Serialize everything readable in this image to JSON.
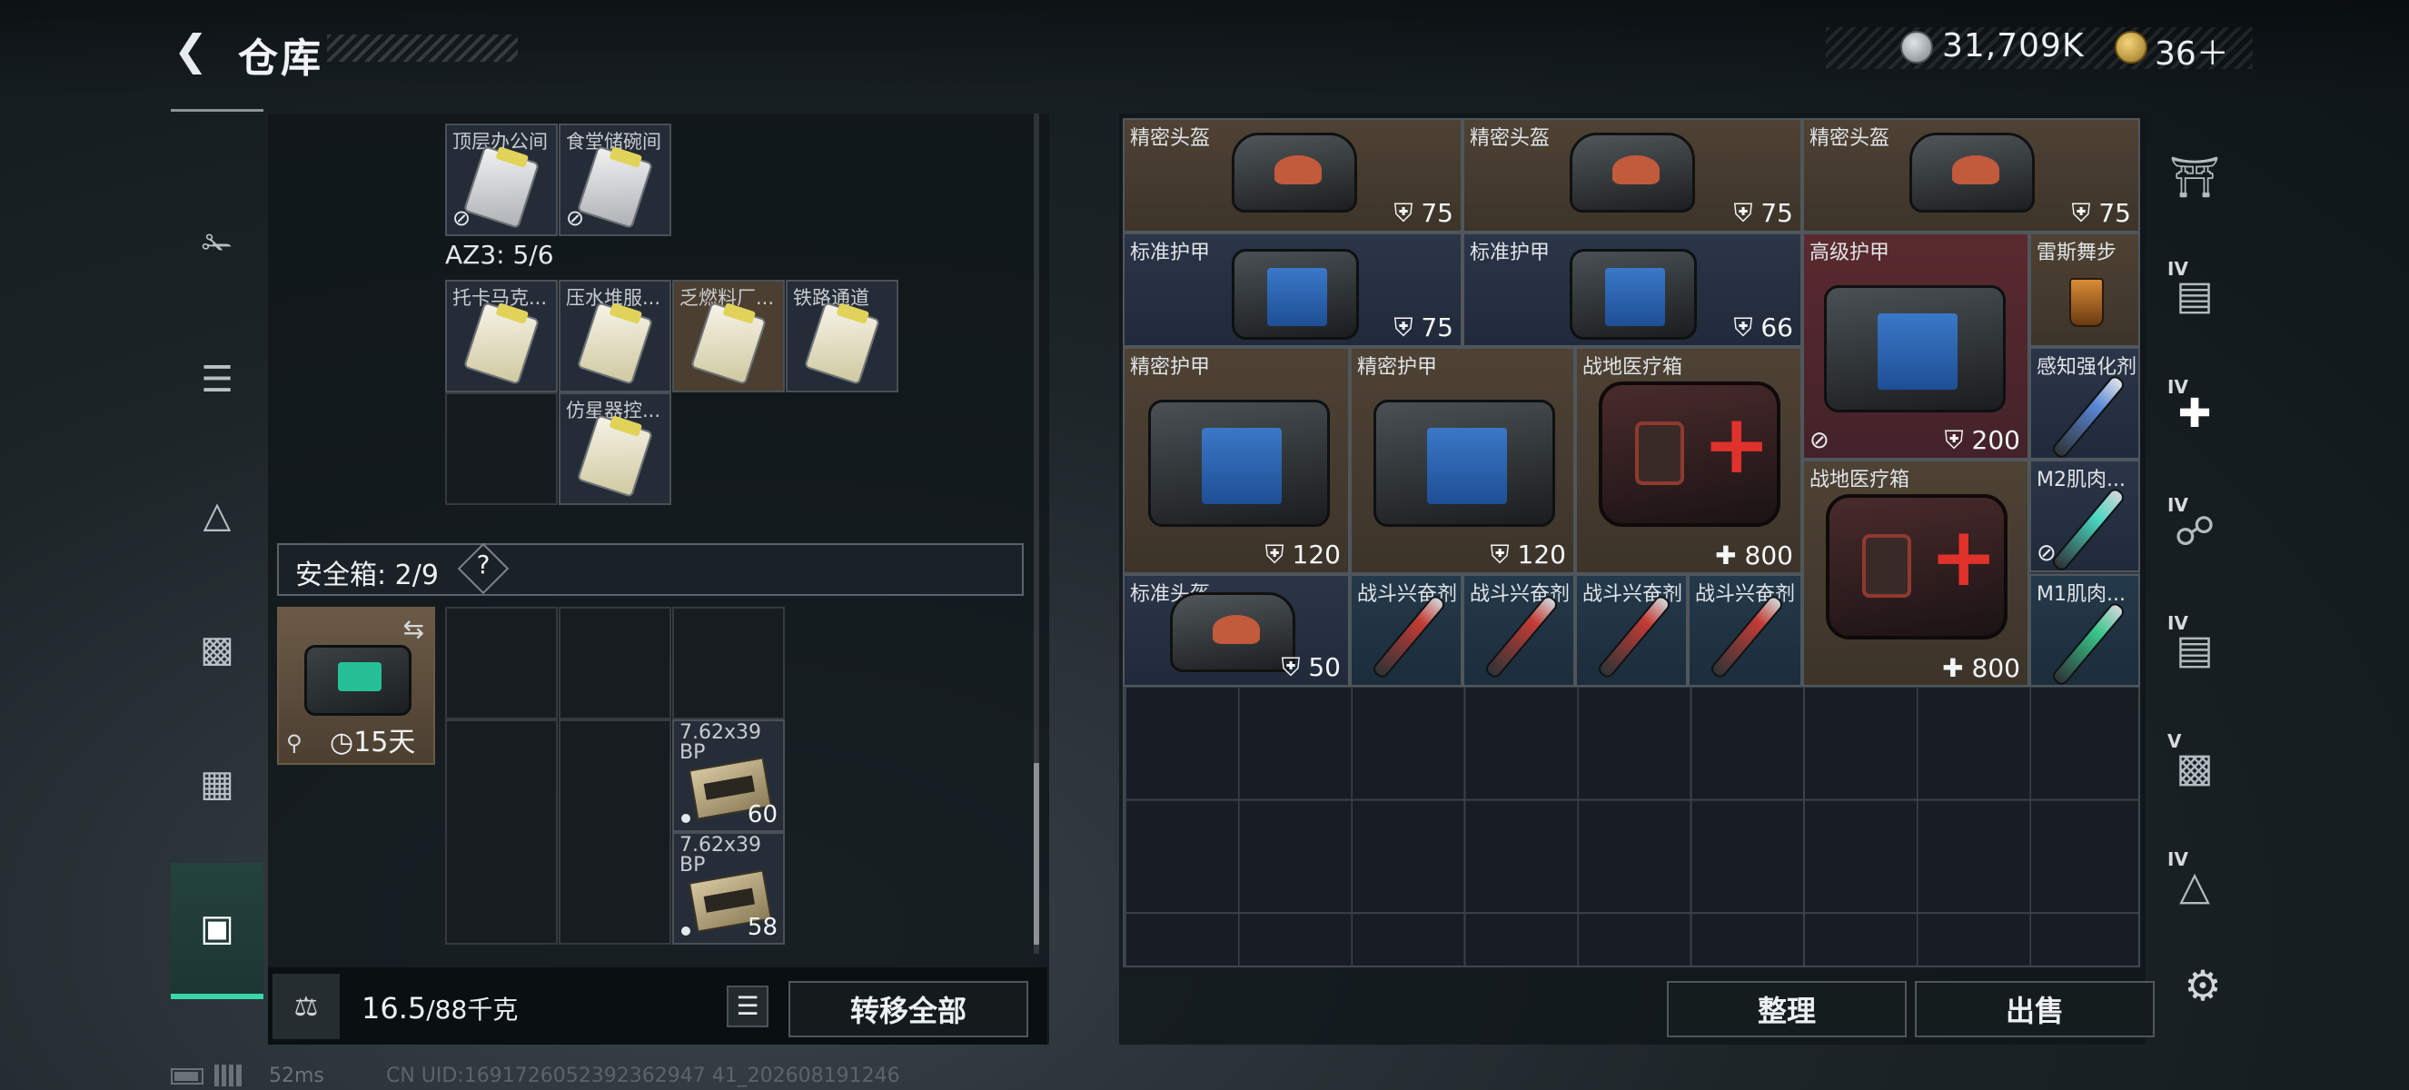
{
  "header": {
    "back_icon": "back-arrow-icon",
    "title": "仓库",
    "currency": {
      "icon": "silver-coin-icon",
      "value": "31,709K"
    },
    "premium": {
      "icon": "gold-coin-icon",
      "value": "36＋"
    }
  },
  "left_rail": {
    "items": [
      {
        "icon": "gun-icon"
      },
      {
        "icon": "vest-icon"
      },
      {
        "icon": "bag-icon"
      },
      {
        "icon": "backpack-icon"
      },
      {
        "icon": "container-icon"
      },
      {
        "icon": "briefcase-icon",
        "active": true
      }
    ]
  },
  "keycards": {
    "top_row": [
      {
        "label": "顶层办公间",
        "no_drop": true
      },
      {
        "label": "食堂储碗间",
        "no_drop": true
      }
    ],
    "az3_label": "AZ3: 5/6",
    "az3_row1": [
      {
        "label": "托卡马克..."
      },
      {
        "label": "压水堆服..."
      },
      {
        "label": "乏燃料厂..."
      },
      {
        "label": "铁路通道"
      }
    ],
    "az3_row2": [
      {
        "label": "仿星器控..."
      }
    ]
  },
  "safebox": {
    "title": "安全箱: 2/9",
    "help": "?",
    "timer": "15天",
    "items": [
      {
        "label": "7.62x39 BP",
        "qty": "60"
      },
      {
        "label": "7.62x39 BP",
        "qty": "58"
      }
    ]
  },
  "weight": {
    "current": "16.5",
    "max": "/88千克"
  },
  "buttons": {
    "transfer_all": "转移全部",
    "sort": "整理",
    "sell": "出售"
  },
  "stash": {
    "row1": [
      {
        "name": "精密头盔",
        "value": "75"
      },
      {
        "name": "精密头盔",
        "value": "75"
      },
      {
        "name": "精密头盔",
        "value": "75"
      }
    ],
    "row2": [
      {
        "name": "标准护甲",
        "value": "75"
      },
      {
        "name": "标准护甲",
        "value": "66"
      },
      {
        "name": "高级护甲",
        "value": "200"
      },
      {
        "name": "雷斯舞步"
      }
    ],
    "row3": [
      {
        "name": "精密护甲",
        "value": "120"
      },
      {
        "name": "精密护甲",
        "value": "120"
      },
      {
        "name": "战地医疗箱",
        "value": "800"
      },
      {
        "name": "感知强化剂"
      }
    ],
    "row4": [
      {
        "name": "战地医疗箱",
        "value": "800"
      },
      {
        "name": "M2肌肉..."
      }
    ],
    "row5": [
      {
        "name": "标准头盔",
        "value": "50"
      },
      {
        "name": "战斗兴奋剂"
      },
      {
        "name": "战斗兴奋剂"
      },
      {
        "name": "战斗兴奋剂"
      },
      {
        "name": "战斗兴奋剂"
      },
      {
        "name": "M1肌肉..."
      }
    ]
  },
  "right_rail": {
    "items": [
      {
        "icon": "helmet-slot-icon",
        "level": ""
      },
      {
        "icon": "folder-icon",
        "level": "IV"
      },
      {
        "icon": "medkit-add-icon",
        "level": "IV"
      },
      {
        "icon": "stimulant-icon",
        "level": "IV"
      },
      {
        "icon": "folder-icon",
        "level": "IV"
      },
      {
        "icon": "container-icon",
        "level": "V"
      },
      {
        "icon": "warning-icon",
        "level": "IV"
      }
    ],
    "settings_icon": "gear-icon"
  },
  "status": {
    "ping": "52ms",
    "uid": "CN UID:1691726052392362947 41_202608191246"
  }
}
